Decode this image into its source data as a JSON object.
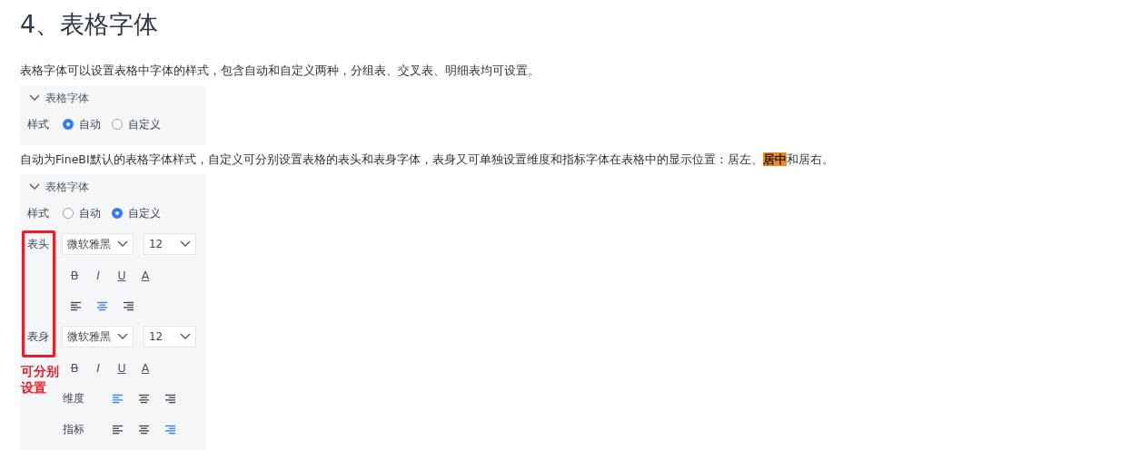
{
  "title": "4、表格字体",
  "intro": "表格字体可以设置表格中字体的样式，包含自动和自定义两种，分组表、交叉表、明细表均可设置。",
  "panel_auto": {
    "header": "表格字体",
    "expanded": true,
    "style_label": "样式",
    "options": [
      {
        "label": "自动",
        "selected": true
      },
      {
        "label": "自定义",
        "selected": false
      }
    ]
  },
  "description": "自动为FineBI默认的表格字体样式，自定义可分别设置表格的表头和表身字体，表身又可单独设置维度和指标字体在表格中的显示位置：居左、**居中**和居右。",
  "panel_custom": {
    "header": "表格字体",
    "expanded": true,
    "style_label": "样式",
    "options": [
      {
        "label": "自动",
        "selected": false
      },
      {
        "label": "自定义",
        "selected": true
      }
    ],
    "sections": [
      {
        "label": "表头",
        "font": "微软雅黑",
        "size": "12",
        "styles": [
          "B",
          "I",
          "U",
          "A"
        ],
        "align_rows": [
          {
            "options": [
              {
                "kind": "left",
                "selected": false
              },
              {
                "kind": "center",
                "selected": true
              },
              {
                "kind": "right",
                "selected": false
              }
            ]
          }
        ]
      },
      {
        "label": "表身",
        "font": "微软雅黑",
        "size": "12",
        "styles": [
          "B",
          "I",
          "U",
          "A"
        ],
        "align_rows": [
          {
            "label": "维度",
            "options": [
              {
                "kind": "left",
                "selected": true
              },
              {
                "kind": "center",
                "selected": false
              },
              {
                "kind": "right",
                "selected": false
              }
            ]
          },
          {
            "label": "指标",
            "options": [
              {
                "kind": "left",
                "selected": false
              },
              {
                "kind": "center",
                "selected": false
              },
              {
                "kind": "right",
                "selected": true
              }
            ]
          }
        ]
      }
    ]
  },
  "annotation": "可分别设置"
}
